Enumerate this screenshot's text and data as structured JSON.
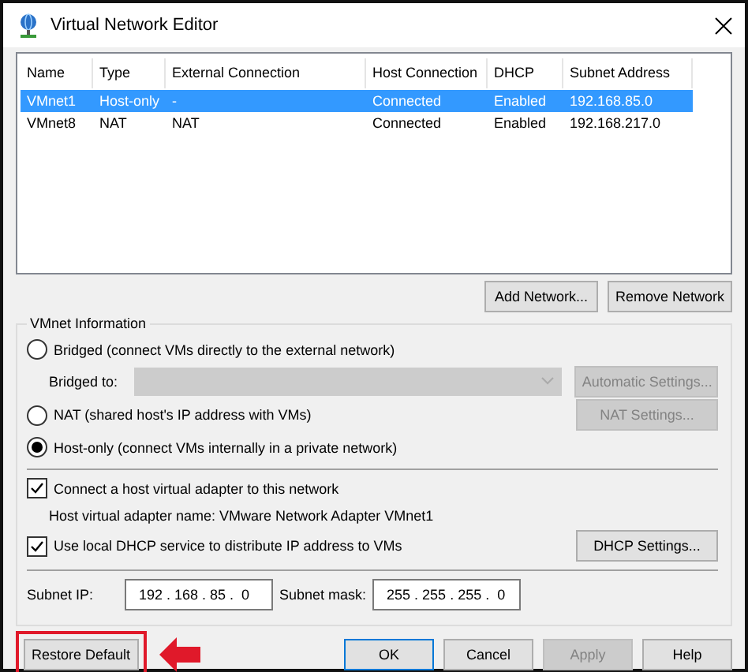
{
  "window": {
    "title": "Virtual Network Editor"
  },
  "table": {
    "columns": [
      "Name",
      "Type",
      "External Connection",
      "Host Connection",
      "DHCP",
      "Subnet Address"
    ],
    "rows": [
      {
        "cells": [
          "VMnet1",
          "Host-only",
          "-",
          "Connected",
          "Enabled",
          "192.168.85.0"
        ],
        "selected": true
      },
      {
        "cells": [
          "VMnet8",
          "NAT",
          "NAT",
          "Connected",
          "Enabled",
          "192.168.217.0"
        ],
        "selected": false
      }
    ]
  },
  "list_buttons": [
    {
      "label": "Add Network...",
      "disabled": false
    },
    {
      "label": "Remove Network",
      "disabled": false
    }
  ],
  "vmnet_info": {
    "title": "VMnet Information",
    "bridged": {
      "label": "Bridged (connect VMs directly to the external network)",
      "selected": false
    },
    "bridged_to": {
      "label": "Bridged to:",
      "disabled": true
    },
    "automatic_settings": {
      "label": "Automatic Settings...",
      "disabled": true
    },
    "nat": {
      "label": "NAT (shared host's IP address with VMs)",
      "selected": false
    },
    "nat_settings": {
      "label": "NAT Settings...",
      "disabled": true
    },
    "host_only": {
      "label": "Host-only (connect VMs internally in a private network)",
      "selected": true
    },
    "connect_adapter": {
      "label": "Connect a host virtual adapter to this network",
      "checked": true
    },
    "adapter_name": "Host virtual adapter name: VMware Network Adapter VMnet1",
    "use_dhcp": {
      "label": "Use local DHCP service to distribute IP address to VMs",
      "checked": true
    },
    "dhcp_settings": {
      "label": "DHCP Settings...",
      "disabled": false
    },
    "subnet_ip": {
      "label": "Subnet IP:",
      "value": "192 . 168 . 85 .  0"
    },
    "subnet_mask": {
      "label": "Subnet mask:",
      "value": "255 . 255 . 255 .  0"
    }
  },
  "footer": {
    "restore_default": "Restore Default",
    "buttons": [
      {
        "label": "OK",
        "default": true,
        "disabled": false
      },
      {
        "label": "Cancel",
        "default": false,
        "disabled": false
      },
      {
        "label": "Apply",
        "default": false,
        "disabled": true
      },
      {
        "label": "Help",
        "default": false,
        "disabled": false
      }
    ]
  }
}
